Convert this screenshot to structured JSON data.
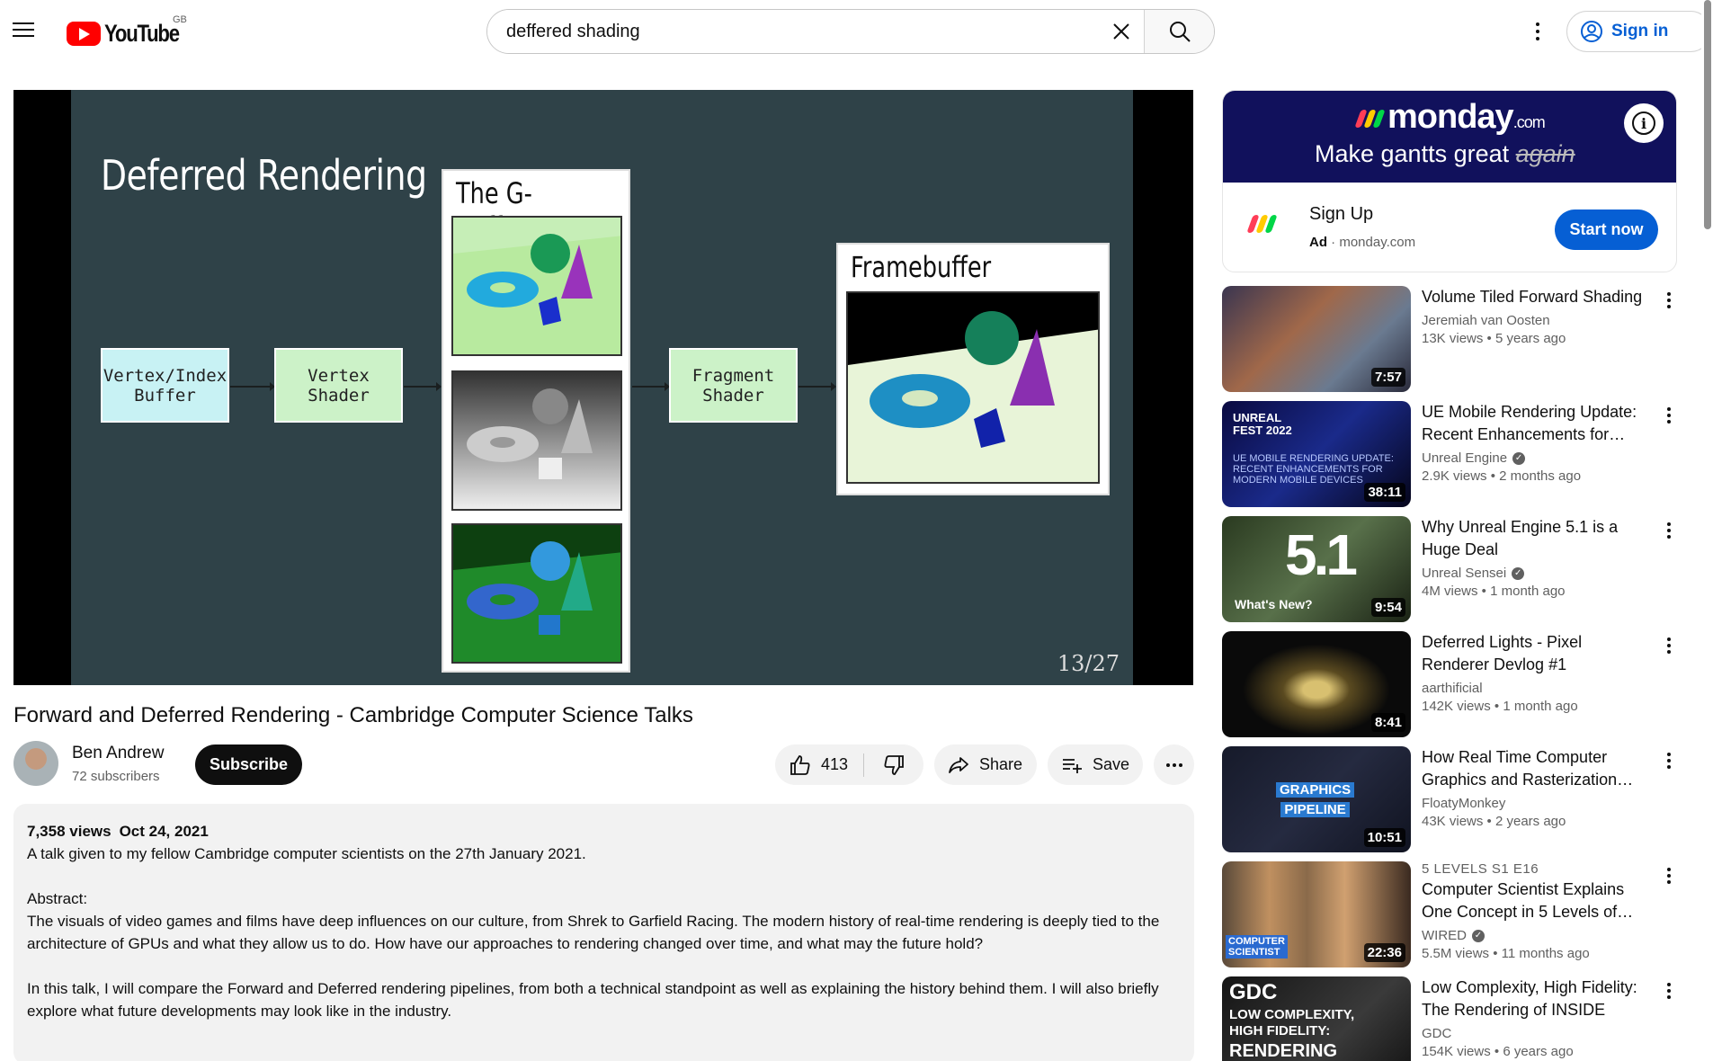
{
  "header": {
    "logo_text": "YouTube",
    "country": "GB",
    "search_value": "deffered shading",
    "signin_label": "Sign in"
  },
  "player": {
    "slide_title": "Deferred Rendering",
    "gbuffer_label": "The G-Buffer",
    "framebuffer_label": "Framebuffer",
    "stages": {
      "vertex_index": "Vertex/Index\nBuffer",
      "vertex_shader": "Vertex\nShader",
      "fragment_shader": "Fragment\nShader"
    },
    "slide_number": "13/27"
  },
  "video": {
    "title": "Forward and Deferred Rendering - Cambridge Computer Science Talks",
    "channel": "Ben Andrew",
    "subscribers": "72 subscribers",
    "subscribe_label": "Subscribe",
    "likes": "413",
    "share_label": "Share",
    "save_label": "Save"
  },
  "description": {
    "views": "7,358 views",
    "date": "Oct 24, 2021",
    "text": "A talk given to my fellow Cambridge computer scientists on the 27th January 2021.\n\nAbstract:\nThe visuals of video games and films have deep influences on our culture, from Shrek to Garfield Racing. The modern history of real-time rendering is deeply tied to the architecture of GPUs and what they allow us to do. How have our approaches to rendering changed over time, and what may the future hold?\n\nIn this talk, I will compare the Forward and Deferred rendering pipelines, from both a technical standpoint as well as explaining the history behind them. I will also briefly explore what future developments may look like in the industry."
  },
  "ad": {
    "brand": "monday",
    "brand_suffix": ".com",
    "tagline_start": "Make gantts great ",
    "tagline_struck": "again",
    "headline": "Sign Up",
    "ad_label": "Ad",
    "domain": "monday.com",
    "cta": "Start now",
    "colors": {
      "banner": "#11115c",
      "cta": "#065fd4",
      "dot1": "#ff3d57",
      "dot2": "#ffcb00",
      "dot3": "#00d647"
    }
  },
  "recommendations": [
    {
      "title": "Volume Tiled Forward Shading",
      "channel": "Jeremiah van Oosten",
      "verified": false,
      "views": "13K views",
      "age": "5 years ago",
      "duration": "7:57",
      "badge": ""
    },
    {
      "title": "UE Mobile Rendering Update: Recent Enhancements for…",
      "channel": "Unreal Engine",
      "verified": true,
      "views": "2.9K views",
      "age": "2 months ago",
      "duration": "38:11",
      "badge": "",
      "thumb_lines": [
        "UNREAL",
        "FEST 2022",
        "UE MOBILE RENDERING UPDATE:",
        "RECENT ENHANCEMENTS FOR",
        "MODERN MOBILE DEVICES"
      ]
    },
    {
      "title": "Why Unreal Engine 5.1 is a Huge Deal",
      "channel": "Unreal Sensei",
      "verified": true,
      "views": "4M views",
      "age": "1 month ago",
      "duration": "9:54",
      "badge": "",
      "thumb_lines": [
        "5.1",
        "What's New?"
      ]
    },
    {
      "title": "Deferred Lights - Pixel Renderer Devlog #1",
      "channel": "aarthificial",
      "verified": false,
      "views": "142K views",
      "age": "1 month ago",
      "duration": "8:41",
      "badge": ""
    },
    {
      "title": "How Real Time Computer Graphics and Rasterization…",
      "channel": "FloatyMonkey",
      "verified": false,
      "views": "43K views",
      "age": "2 years ago",
      "duration": "10:51",
      "badge": "",
      "thumb_lines": [
        "GRAPHICS",
        "PIPELINE"
      ]
    },
    {
      "title": "Computer Scientist Explains One Concept in 5 Levels of…",
      "channel": "WIRED",
      "verified": true,
      "views": "5.5M views",
      "age": "11 months ago",
      "duration": "22:36",
      "badge": "5 LEVELS  S1 E16",
      "thumb_lines": [
        "COMPUTER",
        "SCIENTIST"
      ]
    },
    {
      "title": "Low Complexity, High Fidelity: The Rendering of INSIDE",
      "channel": "GDC",
      "verified": false,
      "views": "154K views",
      "age": "6 years ago",
      "duration": "",
      "badge": "",
      "thumb_lines": [
        "GDC",
        "LOW COMPLEXITY,",
        "HIGH FIDELITY:",
        "RENDERING"
      ]
    }
  ]
}
